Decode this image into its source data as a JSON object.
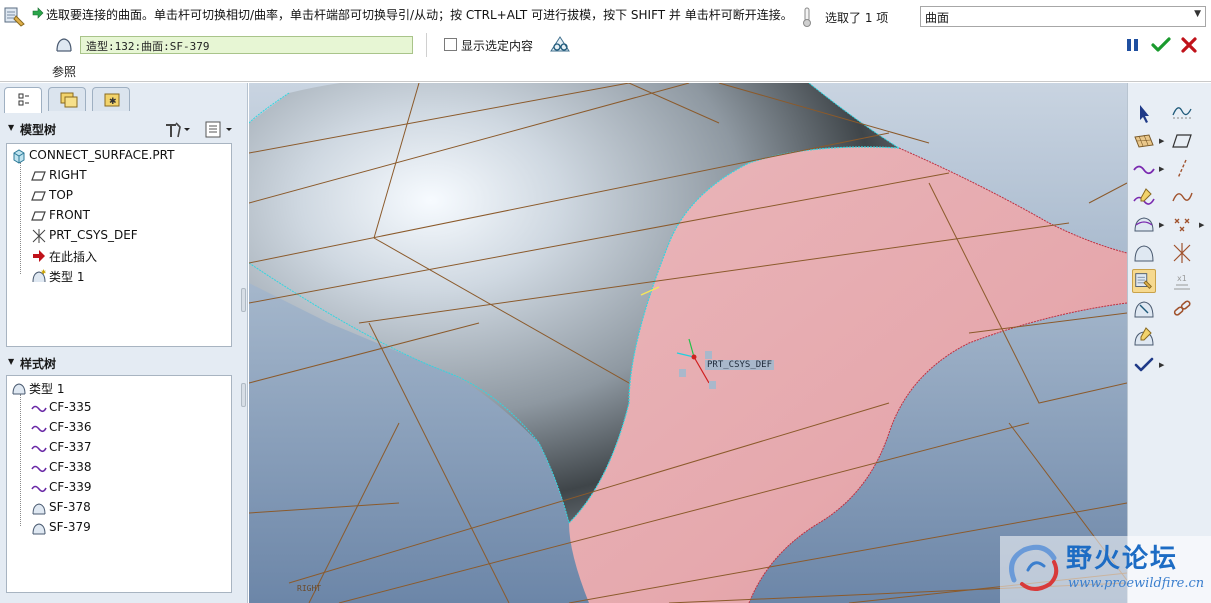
{
  "dashboard": {
    "message": "选取要连接的曲面。单击杆可切换相切/曲率，单击杆端部可切换导引/从动；按 CTRL+ALT 可进行拔模，按下 SHIFT 并 单击杆可断开连接。在更",
    "selection_count": "选取了 1 项",
    "filter_value": "曲面",
    "reference_value": "造型:132:曲面:SF-379",
    "show_selected_label": "显示选定内容",
    "reference_tab": "参照"
  },
  "navigator": {
    "model_tree_title": "模型树",
    "style_tree_title": "样式树",
    "model_tree_items": [
      {
        "label": "CONNECT_SURFACE.PRT",
        "icon": "part-icon"
      },
      {
        "label": "RIGHT",
        "icon": "datum-plane-icon"
      },
      {
        "label": "TOP",
        "icon": "datum-plane-icon"
      },
      {
        "label": "FRONT",
        "icon": "datum-plane-icon"
      },
      {
        "label": "PRT_CSYS_DEF",
        "icon": "csys-icon"
      },
      {
        "label": "在此插入",
        "icon": "insert-here-icon"
      },
      {
        "label": "类型 1",
        "icon": "style-feature-icon"
      }
    ],
    "style_tree_items": [
      {
        "label": "类型 1",
        "icon": "style-feature-icon"
      },
      {
        "label": "CF-335",
        "icon": "curve-icon"
      },
      {
        "label": "CF-336",
        "icon": "curve-icon"
      },
      {
        "label": "CF-337",
        "icon": "curve-icon"
      },
      {
        "label": "CF-338",
        "icon": "curve-icon"
      },
      {
        "label": "CF-339",
        "icon": "curve-icon"
      },
      {
        "label": "SF-378",
        "icon": "surface-icon"
      },
      {
        "label": "SF-379",
        "icon": "surface-icon"
      }
    ]
  },
  "graphics": {
    "csys_label": "PRT_CSYS_DEF",
    "plane_label": "RIGHT"
  },
  "watermark": {
    "title": "野火论坛",
    "url": "www.proewildfire.cn"
  },
  "colors": {
    "accent_green": "#1a9a2e",
    "accent_red": "#c0121a",
    "pause_blue": "#1f4fa0",
    "surface_pink": "#e8a9ad",
    "datum_brown": "#8b5a2b",
    "edge_cyan": "#32d6e0"
  }
}
